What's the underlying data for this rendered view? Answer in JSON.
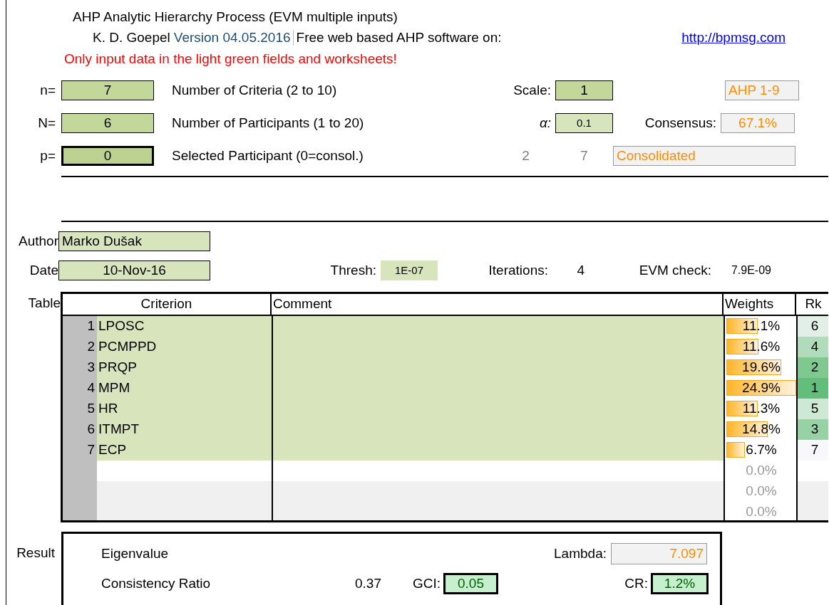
{
  "header": {
    "title": "AHP Analytic Hierarchy Process (EVM multiple inputs)",
    "author": "K. D. Goepel",
    "version": "Version 04.05.2016",
    "tagline": "Free web based AHP software on:",
    "link": "http://bpmsg.com",
    "warning": "Only input data in the light green fields and worksheets!"
  },
  "settings": [
    {
      "label": "n=",
      "value": "7",
      "description": "Number of Criteria (2 to 10)",
      "selected": false
    },
    {
      "label": "N=",
      "value": "6",
      "description": "Number of Participants (1 to 20)",
      "selected": false
    },
    {
      "label": "p=",
      "value": "0",
      "description": "Selected Participant (0=consol.)",
      "selected": true
    }
  ],
  "scale": {
    "label": "Scale:",
    "value": "1",
    "name": "AHP 1-9"
  },
  "alpha": {
    "label": "α:",
    "value": "0.1"
  },
  "consensus": {
    "label": "Consensus:",
    "value": "67.1%"
  },
  "participant_info": {
    "column_1": "2",
    "column_2": "7",
    "status": "Consolidated"
  },
  "author": {
    "label": "Author",
    "value": "Marko Dušak"
  },
  "date": {
    "label": "Date",
    "value": "10-Nov-16"
  },
  "thresh": {
    "label": "Thresh:",
    "value": "1E-07"
  },
  "iterations": {
    "label": "Iterations:",
    "value": "4"
  },
  "evm_check": {
    "label": "EVM check:",
    "value": "7.9E-09"
  },
  "table": {
    "label": "Table",
    "columns": [
      "Criterion",
      "Comment",
      "Weights",
      "Rk"
    ],
    "rows": [
      {
        "kind": "criterion",
        "number": "1",
        "criterion": "LPOSC",
        "weight": "11.1%",
        "level": 0.444,
        "rank": "6",
        "color": "#e2efe6"
      },
      {
        "kind": "criterion",
        "number": "2",
        "criterion": "PCMPPD",
        "weight": "11.6%",
        "level": 0.464,
        "rank": "4",
        "color": "#b0dcbb"
      },
      {
        "kind": "criterion",
        "number": "3",
        "criterion": "PRQP",
        "weight": "19.6%",
        "level": 0.784,
        "rank": "2",
        "color": "#7fc88f"
      },
      {
        "kind": "criterion",
        "number": "4",
        "criterion": "MPM",
        "weight": "24.9%",
        "level": 0.996,
        "rank": "1",
        "color": "#63be7b"
      },
      {
        "kind": "criterion",
        "number": "5",
        "criterion": "HR",
        "weight": "11.3%",
        "level": 0.452,
        "rank": "5",
        "color": "#cde9d4"
      },
      {
        "kind": "criterion",
        "number": "6",
        "criterion": "ITMPT",
        "weight": "14.8%",
        "level": 0.592,
        "rank": "3",
        "color": "#97d2a5"
      },
      {
        "kind": "criterion",
        "number": "7",
        "criterion": "ECP",
        "weight": "6.7%",
        "level": 0.268,
        "rank": "7",
        "color": "#f8f8fc"
      },
      {
        "kind": "blank",
        "shaded": false,
        "weight": "0.0%"
      },
      {
        "kind": "blank",
        "shaded": true,
        "weight": "0.0%"
      },
      {
        "kind": "blank",
        "shaded": true,
        "weight": "0.0%"
      }
    ]
  },
  "result": {
    "label": "Result",
    "eigenvalue": "Eigenvalue",
    "lambda_label": "Lambda:",
    "lambda": "7.097",
    "cr_title": "Consistency Ratio",
    "cr_raw": "0.37",
    "gci_label": "GCI:",
    "gci": "0.05",
    "cr_label": "CR:",
    "cr": "1.2%"
  }
}
